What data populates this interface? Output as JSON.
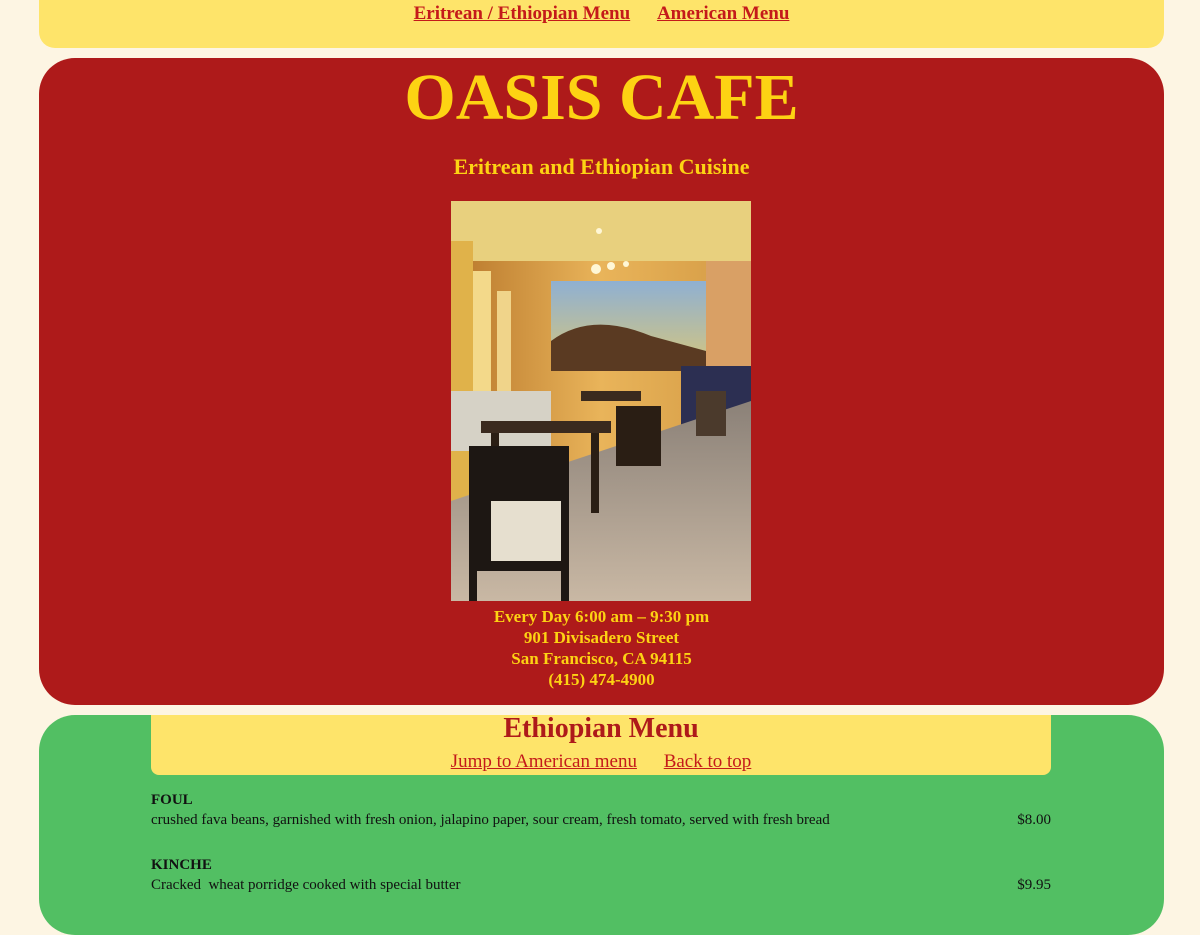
{
  "topnav": {
    "link1": "Eritrean / Ethiopian Menu",
    "link2": "American Menu"
  },
  "hero": {
    "title": "OASIS CAFE",
    "subtitle": "Eritrean and Ethiopian Cuisine",
    "hours": "Every Day 6:00 am – 9:30 pm",
    "street": "901 Divisadero Street",
    "city": "San Francisco, CA 94115",
    "phone": "(415) 474-4900"
  },
  "menu": {
    "title": "Ethiopian Menu",
    "jump_link": "Jump to American menu",
    "back_link": "Back to top",
    "items": [
      {
        "name": "FOUL",
        "desc": "crushed fava beans, garnished with fresh onion, jalapino paper, sour cream, fresh tomato, served with fresh bread",
        "price": "$8.00"
      },
      {
        "name": "KINCHE",
        "desc": "Cracked  wheat porridge cooked with special butter",
        "price": "$9.95"
      }
    ]
  },
  "colors": {
    "page_bg": "#fdf5e3",
    "nav_yellow": "#fee46a",
    "hero_red": "#ae1a1a",
    "hero_text": "#fdd313",
    "menu_green": "#52bf63",
    "link_red": "#c41a1a"
  }
}
